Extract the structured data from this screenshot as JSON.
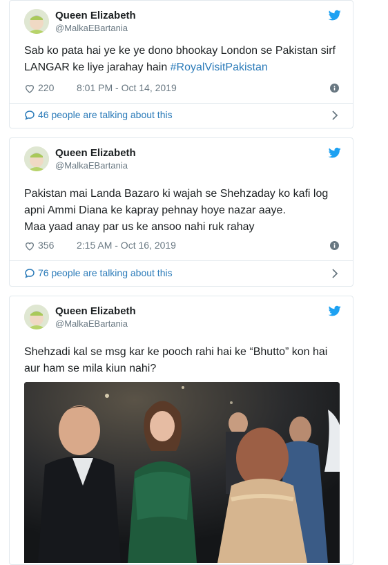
{
  "tweets": [
    {
      "name": "Queen Elizabeth",
      "handle": "@MalkaEBartania",
      "text": "Sab ko pata hai ye ke ye dono bhookay London se Pakistan sirf LANGAR ke liye jarahay hain ",
      "hashtag": "#RoyalVisitPakistan",
      "likes": "220",
      "time": "8:01 PM - Oct 14, 2019",
      "talking": "46 people are talking about this"
    },
    {
      "name": "Queen Elizabeth",
      "handle": "@MalkaEBartania",
      "text": "Pakistan mai Landa Bazaro ki wajah se Shehzaday ko kafi log\napni Ammi Diana ke kapray pehnay hoye nazar aaye.\nMaa yaad anay par us ke ansoo nahi ruk rahay",
      "likes": "356",
      "time": "2:15 AM - Oct 16, 2019",
      "talking": "76 people are talking about this"
    },
    {
      "name": "Queen Elizabeth",
      "handle": "@MalkaEBartania",
      "text": "Shehzadi kal se msg kar ke pooch rahi hai ke “Bhutto” kon hai\naur ham se mila kiun nahi?"
    }
  ],
  "colors": {
    "link": "#2b7bb9",
    "muted": "#697882",
    "border": "#e1e8ed",
    "twitter_blue": "#1da1f2"
  },
  "icons": [
    "twitter-bird-icon",
    "heart-icon",
    "info-icon",
    "speech-bubble-icon",
    "chevron-right-icon"
  ]
}
